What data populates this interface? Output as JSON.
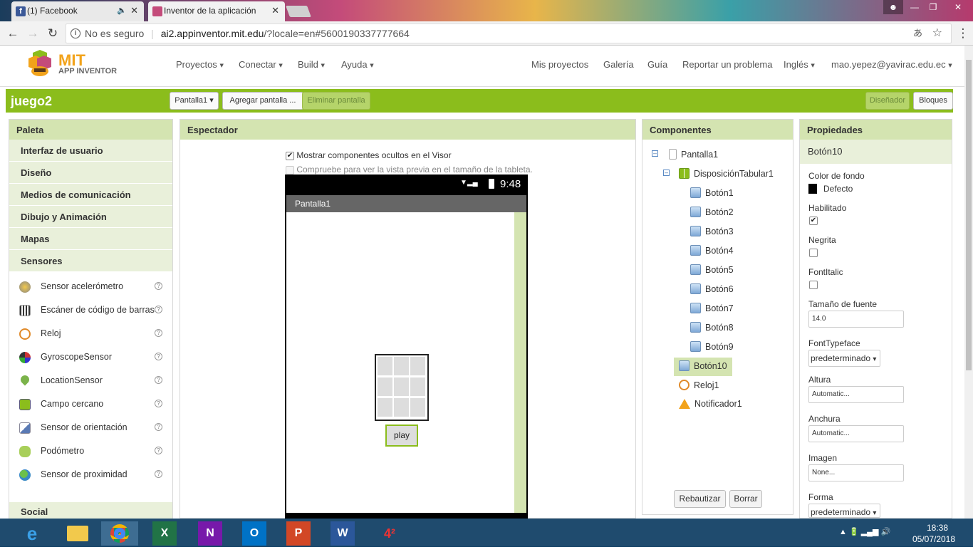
{
  "browser": {
    "tabs": [
      {
        "title": "(1) Facebook",
        "favicon": "facebook-icon",
        "color": "#3b5998"
      },
      {
        "title": "Inventor de la aplicación",
        "favicon": "app-inventor-icon",
        "color": "#c44b7a"
      }
    ],
    "security": "No es seguro",
    "url_domain": "ai2.appinventor.mit.edu",
    "url_rest": "/?locale=en#5600190337777664"
  },
  "header": {
    "logo_top": "MIT",
    "logo_bottom": "APP INVENTOR",
    "menu_left": [
      "Proyectos",
      "Conectar",
      "Build",
      "Ayuda"
    ],
    "menu_right": [
      "Mis proyectos",
      "Galería",
      "Guía",
      "Reportar un problema"
    ],
    "language": "Inglés",
    "user": "mao.yepez@yavirac.edu.ec"
  },
  "toolbar": {
    "project": "juego2",
    "screen_select": "Pantalla1",
    "add_screen": "Agregar pantalla ...",
    "remove_screen": "Eliminar pantalla",
    "designer": "Diseñador",
    "blocks": "Bloques"
  },
  "palette": {
    "title": "Paleta",
    "categories": [
      "Interfaz de usuario",
      "Diseño",
      "Medios de comunicación",
      "Dibujo y Animación",
      "Mapas",
      "Sensores"
    ],
    "sensor_items": [
      {
        "label": "Sensor acelerómetro",
        "icon": "accelerometer-icon"
      },
      {
        "label": "Escáner de código de barras",
        "icon": "barcode-icon"
      },
      {
        "label": "Reloj",
        "icon": "clock-icon"
      },
      {
        "label": "GyroscopeSensor",
        "icon": "gyroscope-icon"
      },
      {
        "label": "LocationSensor",
        "icon": "location-icon"
      },
      {
        "label": "Campo cercano",
        "icon": "nfc-icon"
      },
      {
        "label": "Sensor de orientación",
        "icon": "orientation-icon"
      },
      {
        "label": "Podómetro",
        "icon": "pedometer-icon"
      },
      {
        "label": "Sensor de proximidad",
        "icon": "proximity-icon"
      }
    ],
    "help": "?",
    "bottom_category": "Social"
  },
  "viewer": {
    "title": "Espectador",
    "show_hidden": "Mostrar componentes ocultos en el Visor",
    "tablet_preview": "Compruebe para ver la vista previa en el tamaño de la tableta.",
    "time": "9:48",
    "screen_title": "Pantalla1",
    "play_label": "play"
  },
  "components": {
    "title": "Componentes",
    "root": "Pantalla1",
    "arrangement": "DisposiciónTabular1",
    "buttons": [
      "Botón1",
      "Botón2",
      "Botón3",
      "Botón4",
      "Botón5",
      "Botón6",
      "Botón7",
      "Botón8",
      "Botón9"
    ],
    "others": [
      "Botón10",
      "Reloj1",
      "Notificador1"
    ],
    "rename": "Rebautizar",
    "delete": "Borrar"
  },
  "properties": {
    "title": "Propiedades",
    "component": "Botón10",
    "bg_color_label": "Color de fondo",
    "bg_color_value": "Defecto",
    "enabled_label": "Habilitado",
    "bold_label": "Negrita",
    "italic_label": "FontItalic",
    "font_size_label": "Tamaño de fuente",
    "font_size_value": "14.0",
    "typeface_label": "FontTypeface",
    "typeface_value": "predeterminado",
    "height_label": "Altura",
    "height_value": "Automatic...",
    "width_label": "Anchura",
    "width_value": "Automatic...",
    "image_label": "Imagen",
    "image_value": "None...",
    "shape_label": "Forma",
    "shape_value": "predeterminado"
  },
  "taskbar": {
    "apps": [
      "internet-explorer-icon",
      "file-explorer-icon",
      "chrome-icon",
      "excel-icon",
      "onenote-icon",
      "outlook-icon",
      "powerpoint-icon",
      "word-icon",
      "game-icon"
    ],
    "time": "18:38",
    "date": "05/07/2018"
  },
  "colors": {
    "accent_green": "#8bbd1c",
    "panel_header": "#d4e4b1"
  }
}
